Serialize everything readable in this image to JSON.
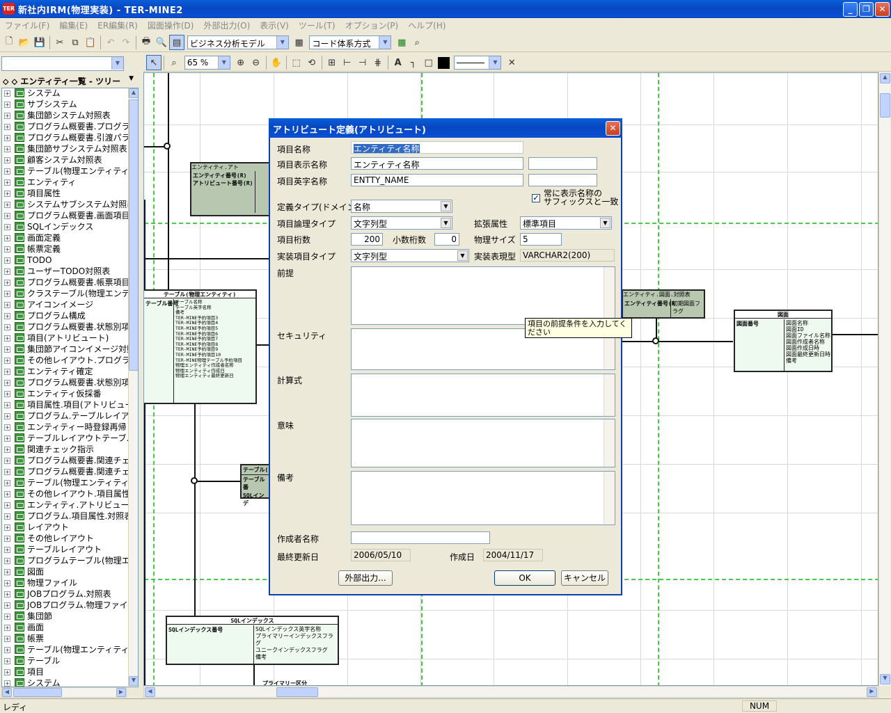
{
  "window": {
    "title": "新社内IRM(物理実装) - TER-MINE2",
    "app_icon": "TER"
  },
  "menu": [
    "ファイル(F)",
    "編集(E)",
    "ER編集(R)",
    "図面操作(D)",
    "外部出力(O)",
    "表示(V)",
    "ツール(T)",
    "オプション(P)",
    "ヘルプ(H)"
  ],
  "toolbar1": {
    "model_combo": "ビジネス分析モデル",
    "code_combo": "コード体系方式"
  },
  "toolbar2": {
    "zoom": "65 %"
  },
  "tree": {
    "header": "エンティティ一覧 - ツリー",
    "items": [
      "システム",
      "サブシステム",
      "集団節システム対照表",
      "プログラム概要書.プログラムア",
      "プログラム概要書.引渡パラメー",
      "集団節サブシステム対照表",
      "顧客システム対照表",
      "テーブル(物理エンティティ)",
      "エンティティ",
      "項目属性",
      "システムサブシステム対照表",
      "プログラム概要書.画面項目表",
      "SQLインデックス",
      "画面定義",
      "帳票定義",
      "TODO",
      "ユーザーTODO対照表",
      "プログラム概要書.帳票項目印",
      "クラステーブル(物理エンティティ",
      "アイコンイメージ",
      "プログラム構成",
      "プログラム概要書.状態別項目",
      "項目(アトリビュート)",
      "集団節アイコンイメージ対照表",
      "その他レイアウト.プログラム.対照",
      "エンティティ確定",
      "プログラム概要書.状態別項目",
      "エンティティ仮採番",
      "項目属性.項目(アトリビュート)",
      "プログラム.テーブルレイアウト.対",
      "エンティティー時登録再帰",
      "テーブルレイアウトテーブル(物",
      "関連チェック指示",
      "プログラム概要書.関連チェック",
      "プログラム概要書.関連チェック",
      "テーブル(物理エンティティ).項目",
      "その他レイアウト.項目属性.対照",
      "エンティティ.アトリビュート.対照表",
      "プログラム.項目属性.対照表",
      "レイアウト",
      "その他レイアウト",
      "テーブルレイアウト",
      "プログラムテーブル(物理エンテ",
      "図面",
      "物理ファイル",
      "JOBプログラム.対照表",
      "JOBプログラム.物理ファイル.対",
      "集団節",
      "画面",
      "帳票",
      "テーブル(物理エンティティ).SQ",
      "テーブル",
      "項目",
      "システム"
    ]
  },
  "dialog": {
    "title": "アトリビュート定義(アトリビュート)",
    "item_name_label": "項目名称",
    "item_name": "エンティティ名称",
    "display_name_label": "項目表示名称",
    "display_name": "エンティティ名称",
    "display_suffix": "",
    "english_name_label": "項目英字名称",
    "english_name": "ENTTY_NAME",
    "english_suffix": "",
    "suffix_checkbox": "常に表示名称の\nサフィックスと一致",
    "domain_label": "定義タイプ(ドメイン)",
    "domain": "名称",
    "logical_type_label": "項目論理タイプ",
    "logical_type": "文字列型",
    "ext_attr_label": "拡張属性",
    "ext_attr": "標準項目",
    "digits_label": "項目桁数",
    "digits": "200",
    "decimal_label": "小数桁数",
    "decimal": "0",
    "phys_size_label": "物理サイズ",
    "phys_size": "5",
    "impl_type_label": "実装項目タイプ",
    "impl_type": "文字列型",
    "impl_expr_label": "実装表現型",
    "impl_expr": "VARCHAR2(200)",
    "premise_label": "前提",
    "security_label": "セキュリティ",
    "formula_label": "計算式",
    "meaning_label": "意味",
    "remarks_label": "備考",
    "author_label": "作成者名称",
    "author": "",
    "updated_label": "最終更新日",
    "updated": "2006/05/10",
    "created_label": "作成日",
    "created": "2004/11/17",
    "export_button": "外部出力...",
    "ok_button": "OK",
    "cancel_button": "キャンセル"
  },
  "tooltip": "項目の前提条件を入力してください",
  "diagram": {
    "table_entity": {
      "title": "テーブル(物理エンティティ)",
      "key": "テーブル番号",
      "attrs": [
        "テーブル名称",
        "テーブル英字名称",
        "備考",
        "TER-MINE予約項目3",
        "TER-MINE予約項目4",
        "TER-MINE予約項目5",
        "TER-MINE予約項目6",
        "TER-MINE予約項目7",
        "TER-MINE予約項目8",
        "TER-MINE予約項目9",
        "TER-MINE予約項目10",
        "TER-MINE物理テーブル予約項目",
        "物理エンティティ作成者名称",
        "物理エンティティ作成日",
        "物理エンティティ最終更新日"
      ]
    },
    "entity_attr": {
      "title": "エンティティ.アト",
      "keys": [
        "エンティティ番号(R)",
        "アトリビュート番号(R)"
      ]
    },
    "entity_zumen": {
      "title": "エンティティ.図面.対照表",
      "keys": "エンティティ番号(R",
      "attrs": "初期図面フラグ"
    },
    "zumen": {
      "title": "図面",
      "key": "図面番号",
      "attrs": [
        "図面名称",
        "図面ID",
        "図面ファイル名称",
        "図面作成者名称",
        "図面作成日時",
        "図面最終更新日時",
        "備考"
      ]
    },
    "sql_index": {
      "title": "SQLインデックス",
      "key": "SQLインデックス番号",
      "attrs": [
        "SQLインデックス英字名称",
        "プライマリーインデックスフラグ",
        "ユニークインデックスフラグ",
        "備考"
      ]
    },
    "table_sql": {
      "title": "テーブル(",
      "keys": [
        "テーブル番",
        "SQLインデ"
      ]
    },
    "primary_label": "プライマリー区分"
  },
  "status": {
    "text": "レディ",
    "num": "NUM"
  }
}
